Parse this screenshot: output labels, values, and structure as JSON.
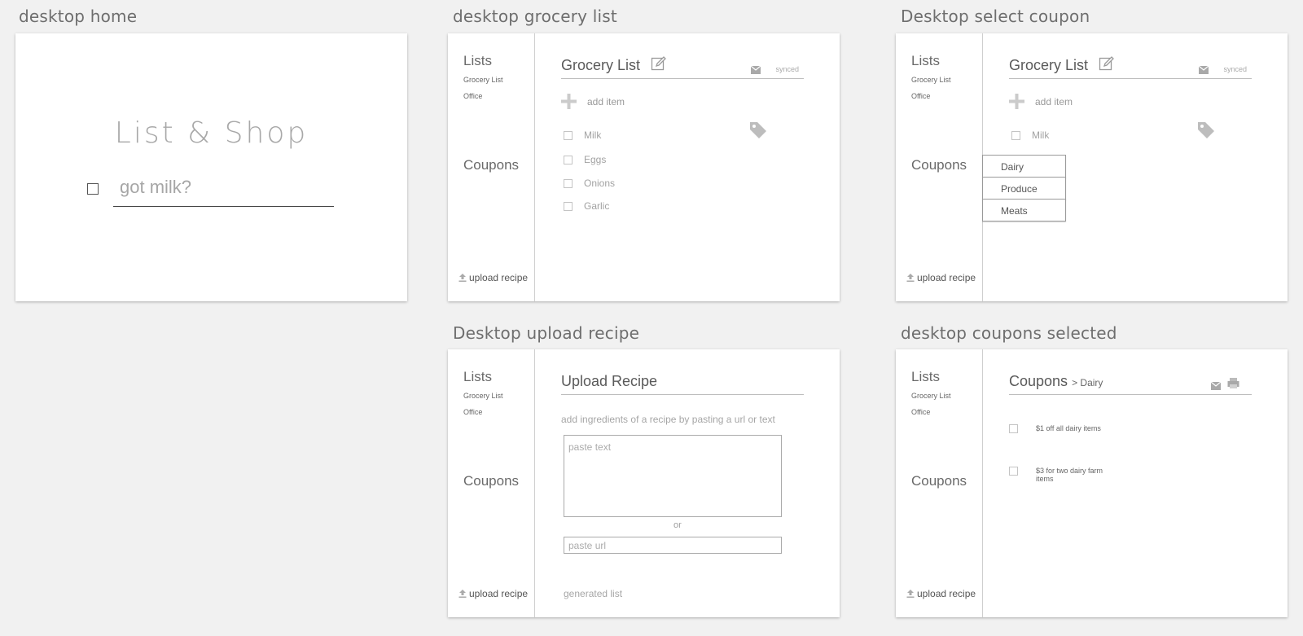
{
  "frames": {
    "home": {
      "title": "desktop home",
      "app_title": "List & Shop",
      "input_placeholder": "got milk?"
    },
    "grocery": {
      "title": "desktop grocery list",
      "list_title": "Grocery List",
      "synced": "synced",
      "add_item": "add item",
      "items": [
        "Milk",
        "Eggs",
        "Onions",
        "Garlic"
      ]
    },
    "select_coupon": {
      "title": "Desktop select coupon",
      "list_title": "Grocery List",
      "synced": "synced",
      "add_item": "add item",
      "items": [
        "Milk"
      ],
      "dropdown_options": [
        "Dairy",
        "Produce",
        "Meats"
      ]
    },
    "upload": {
      "title": "Desktop upload recipe",
      "heading": "Upload Recipe",
      "hint": "add ingredients of a recipe by pasting a url or text",
      "paste_text_placeholder": "paste text",
      "or": "or",
      "paste_url_placeholder": "paste url",
      "generated_list": "generated list"
    },
    "coupons_selected": {
      "title": "desktop coupons selected",
      "heading": "Coupons",
      "breadcrumb": "> Dairy",
      "coupons": [
        "$1 off all dairy items",
        "$3 for two dairy farm items"
      ]
    }
  },
  "sidebar": {
    "lists_heading": "Lists",
    "list_items": [
      "Grocery List",
      "Office"
    ],
    "coupons_heading": "Coupons",
    "upload_recipe": "upload recipe"
  },
  "colors": {
    "background": "#f1f1f1",
    "artboard": "#ffffff",
    "icon_gray": "#c6c6c6"
  }
}
